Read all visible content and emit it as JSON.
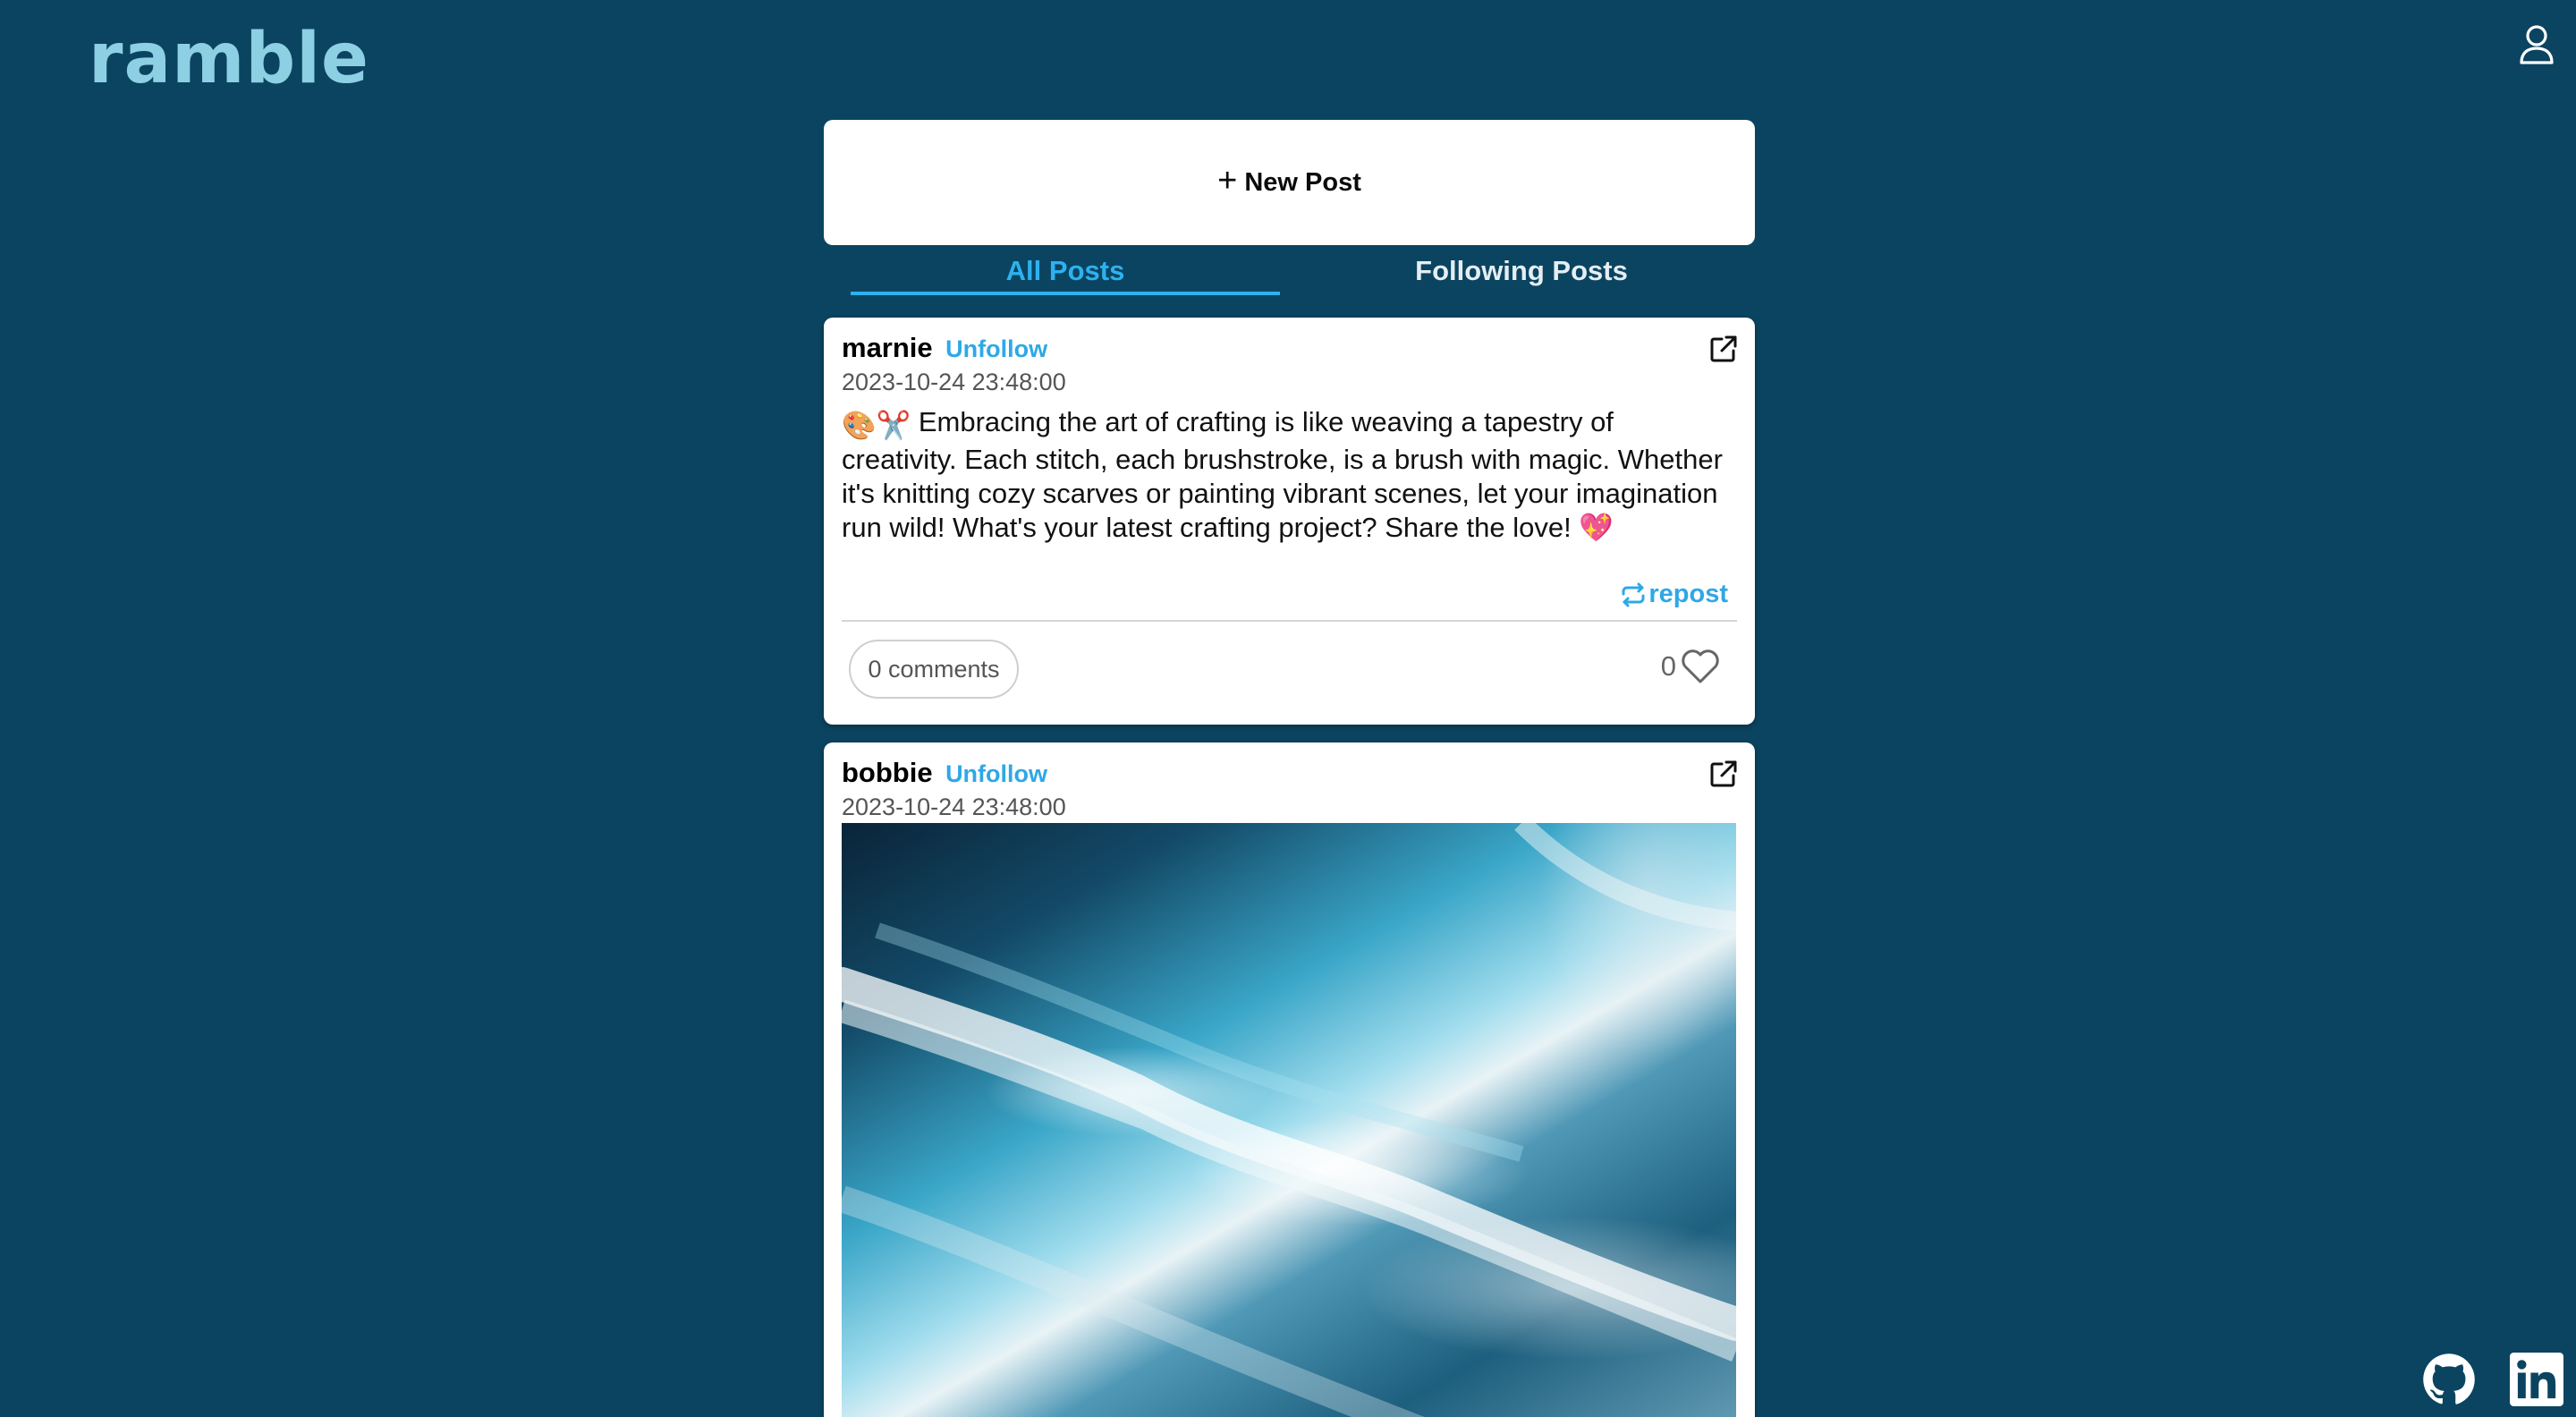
{
  "header": {
    "logo": "ramble"
  },
  "feed": {
    "new_post_label": "New Post",
    "tabs": [
      {
        "label": "All Posts",
        "active": true
      },
      {
        "label": "Following Posts",
        "active": false
      }
    ],
    "posts": [
      {
        "username": "marnie",
        "follow_label": "Unfollow",
        "timestamp": "2023-10-24 23:48:00",
        "text": "Embracing the art of crafting is like weaving a tapestry of creativity. Each stitch, each brushstroke, is a brush with magic. Whether it's knitting cozy scarves or painting vibrant scenes, let your imagination run wild! What's your latest crafting project? Share the love!",
        "leading_emojis": "🎨✂️",
        "trailing_emoji": "💖",
        "repost_label": "repost",
        "comments_label": "0 comments",
        "likes": "0"
      },
      {
        "username": "bobbie",
        "follow_label": "Unfollow",
        "timestamp": "2023-10-24 23:48:00",
        "image": "ocean-wave-aerial-photo"
      }
    ]
  },
  "icons": {
    "profile": "user-icon",
    "open": "external-link-icon",
    "repost": "repost-icon",
    "like": "heart-icon",
    "github": "github-icon",
    "linkedin": "linkedin-icon"
  },
  "colors": {
    "background": "#0b4460",
    "accent": "#2ea8e6",
    "logo": "#8dcfe3"
  }
}
